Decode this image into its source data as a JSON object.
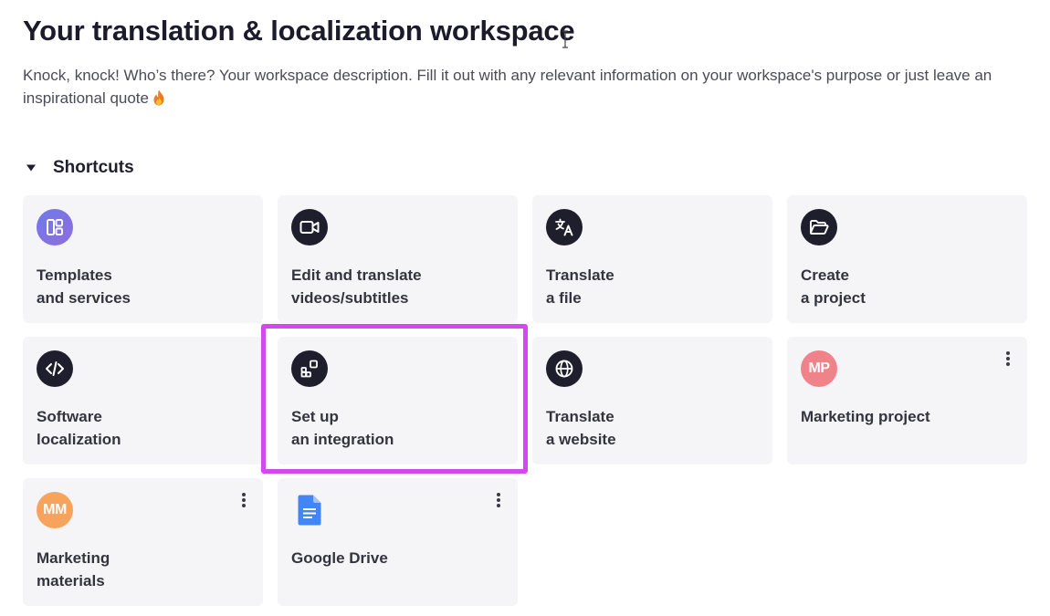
{
  "workspace": {
    "title": "Your translation & localization workspace",
    "description": "Knock, knock! Who’s there? Your workspace description. Fill it out with any relevant information on your workspace's purpose or just leave an inspirational quote"
  },
  "shortcuts": {
    "label": "Shortcuts",
    "expanded": true,
    "cards": [
      {
        "icon": "templates-icon",
        "line1": "Templates",
        "line2": "and services"
      },
      {
        "icon": "video-camera-icon",
        "line1": "Edit and translate",
        "line2": "videos/subtitles"
      },
      {
        "icon": "translate-icon",
        "line1": "Translate",
        "line2": "a file"
      },
      {
        "icon": "folder-open-icon",
        "line1": "Create",
        "line2": "a project"
      },
      {
        "icon": "code-icon",
        "line1": "Software",
        "line2": "localization"
      },
      {
        "icon": "integration-icon",
        "line1": "Set up",
        "line2": "an integration",
        "highlighted": true
      },
      {
        "icon": "globe-icon",
        "line1": "Translate",
        "line2": "a website"
      },
      {
        "icon": "avatar",
        "avatar_initials": "MP",
        "avatar_color": "#f0828a",
        "line1": "Marketing project",
        "line2": "",
        "has_menu": true
      },
      {
        "icon": "avatar",
        "avatar_initials": "MM",
        "avatar_color": "#f7a35c",
        "line1": "Marketing",
        "line2": "materials",
        "has_menu": true
      },
      {
        "icon": "google-docs-icon",
        "line1": "Google Drive",
        "line2": "",
        "has_menu": true
      }
    ]
  },
  "colors": {
    "card_background": "#f5f5f7",
    "icon_background": "#1e1e2d",
    "highlight_border": "#d348ef",
    "google_doc_blue": "#4285f4"
  }
}
